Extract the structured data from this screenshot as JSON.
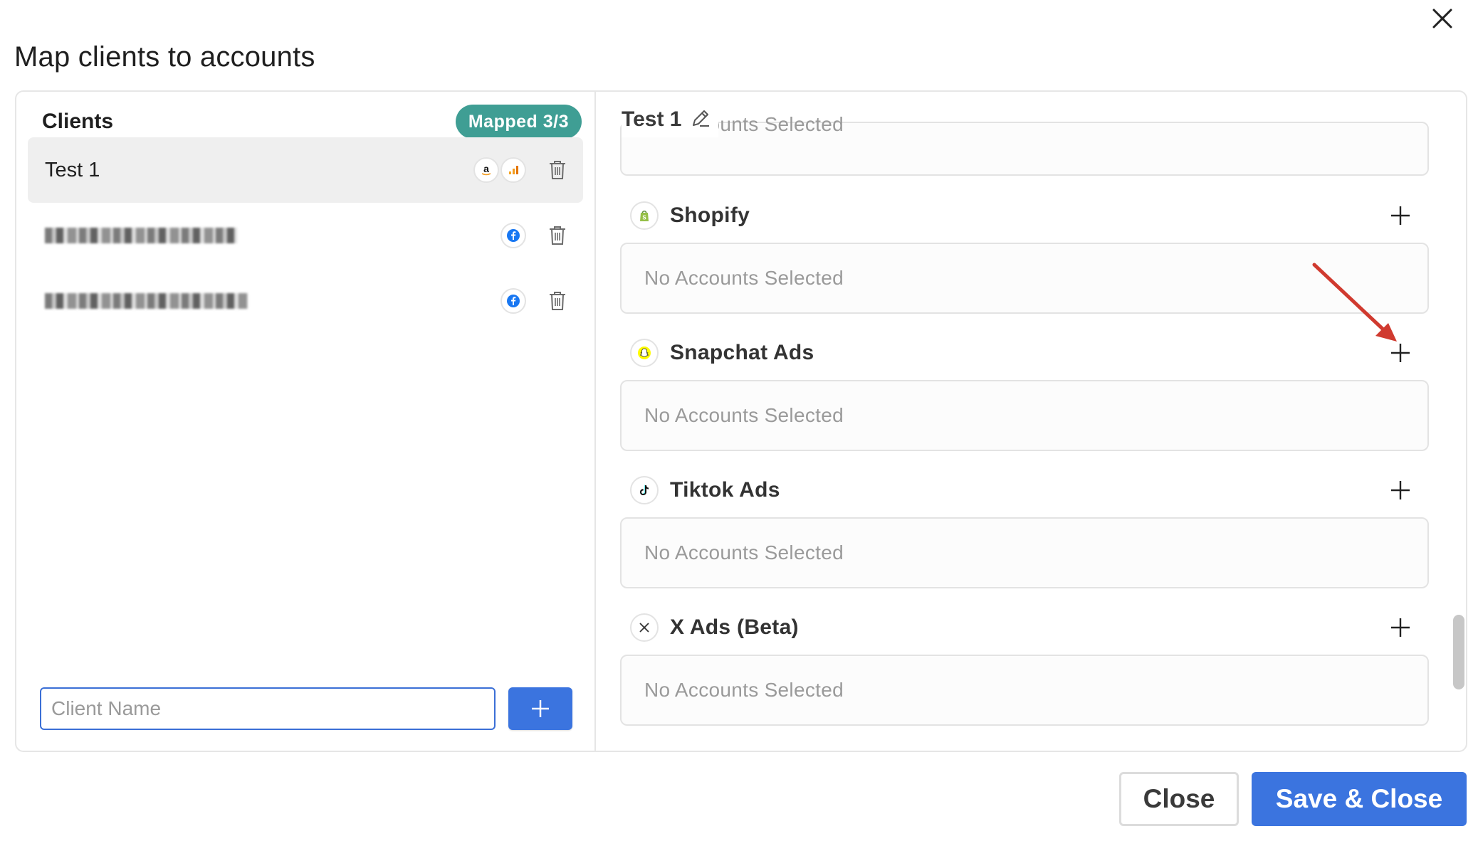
{
  "dialog": {
    "title": "Map clients to accounts"
  },
  "clients_panel": {
    "title": "Clients",
    "mapped_badge": "Mapped 3/3",
    "clients": [
      {
        "name": "Test 1",
        "platforms": [
          "amazon-icon",
          "google-analytics-icon"
        ],
        "selected": true
      },
      {
        "name": "",
        "platforms": [
          "facebook-icon"
        ],
        "selected": false,
        "redacted": true
      },
      {
        "name": "",
        "platforms": [
          "facebook-icon"
        ],
        "selected": false,
        "redacted": true
      }
    ],
    "new_client_placeholder": "Client Name"
  },
  "client_detail": {
    "client_name": "Test 1",
    "platforms": [
      {
        "name": "Shopify",
        "icon": "shopify-icon",
        "accounts_text": "No Accounts Selected"
      },
      {
        "name": "Snapchat Ads",
        "icon": "snapchat-icon",
        "accounts_text": "No Accounts Selected"
      },
      {
        "name": "Tiktok Ads",
        "icon": "tiktok-icon",
        "accounts_text": "No Accounts Selected"
      },
      {
        "name": "X Ads (Beta)",
        "icon": "x-icon",
        "accounts_text": "No Accounts Selected"
      }
    ],
    "clipped_top_text": "No Accounts Selected"
  },
  "footer": {
    "close_label": "Close",
    "save_label": "Save & Close"
  },
  "colors": {
    "primary": "#3b74df",
    "mapped_badge": "#3f9e94",
    "annotation_arrow": "#d03a2f"
  }
}
